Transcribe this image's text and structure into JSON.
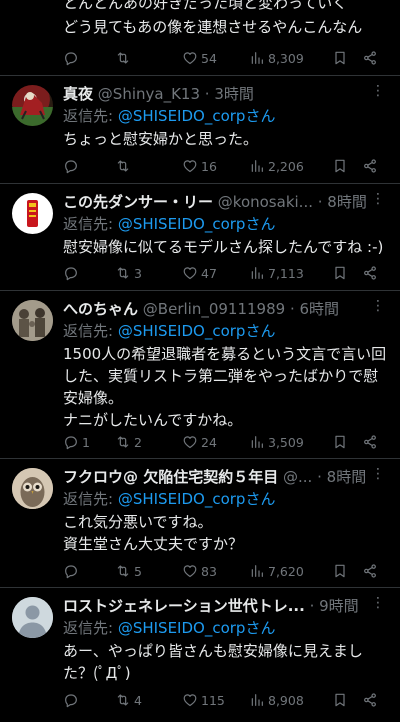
{
  "top": {
    "line1": "とんとんあの好きだった頃と変わっていく",
    "line2": "どう見てもあの像を連想させるやんこんなん",
    "likes": "54",
    "views": "8,309"
  },
  "reply_prefix": "返信先: ",
  "tweets": [
    {
      "name": "真夜",
      "handle": "@Shinya_K13",
      "time": "· 3時間",
      "mention": "@SHISEIDO_corpさん",
      "lines": [
        "ちょっと慰安婦かと思った。"
      ],
      "replies": "",
      "retweets": "",
      "likes": "16",
      "views": "2,206"
    },
    {
      "name": "この先ダンサー・リー",
      "handle": "@konosaki...",
      "time": "· 8時間",
      "mention": "@SHISEIDO_corpさん",
      "lines": [
        "慰安婦像に似てるモデルさん探したんですね :-)"
      ],
      "replies": "",
      "retweets": "3",
      "likes": "47",
      "views": "7,113"
    },
    {
      "name": "へのちゃん",
      "handle": "@Berlin_09111989",
      "time": "· 6時間",
      "mention": "@SHISEIDO_corpさん",
      "lines": [
        "1500人の希望退職者を募るという文言で言い回",
        "した、実質リストラ第二弾をやったばかりで慰",
        "安婦像。",
        "ナニがしたいんですかね。"
      ],
      "replies": "1",
      "retweets": "2",
      "likes": "24",
      "views": "3,509"
    },
    {
      "name": "フクロウ@ 欠陥住宅契約５年目",
      "handle": "@...",
      "time": "· 8時間",
      "mention": "@SHISEIDO_corpさん",
      "lines": [
        "これ気分悪いですね。",
        "資生堂さん大丈夫ですか？"
      ],
      "replies": "",
      "retweets": "5",
      "likes": "83",
      "views": "7,620"
    },
    {
      "name": "ロストジェネレーション世代トレ...",
      "handle": "",
      "time": "· 9時間",
      "mention": "@SHISEIDO_corpさん",
      "lines": [
        "あー、やっぱり皆さんも慰安婦像に見えまし",
        "た？(ﾟДﾟ)"
      ],
      "replies": "",
      "retweets": "4",
      "likes": "115",
      "views": "8,908"
    }
  ],
  "icons": {
    "reply": "reply-icon",
    "retweet": "retweet-icon",
    "like": "heart-icon",
    "views": "views-icon",
    "bookmark": "bookmark-icon",
    "share": "share-icon",
    "more": "more-icon"
  },
  "colors": {
    "background": "#000000",
    "text": "#e7e9ea",
    "muted": "#71767b",
    "link": "#1d9bf0",
    "divider": "#2f3336"
  }
}
